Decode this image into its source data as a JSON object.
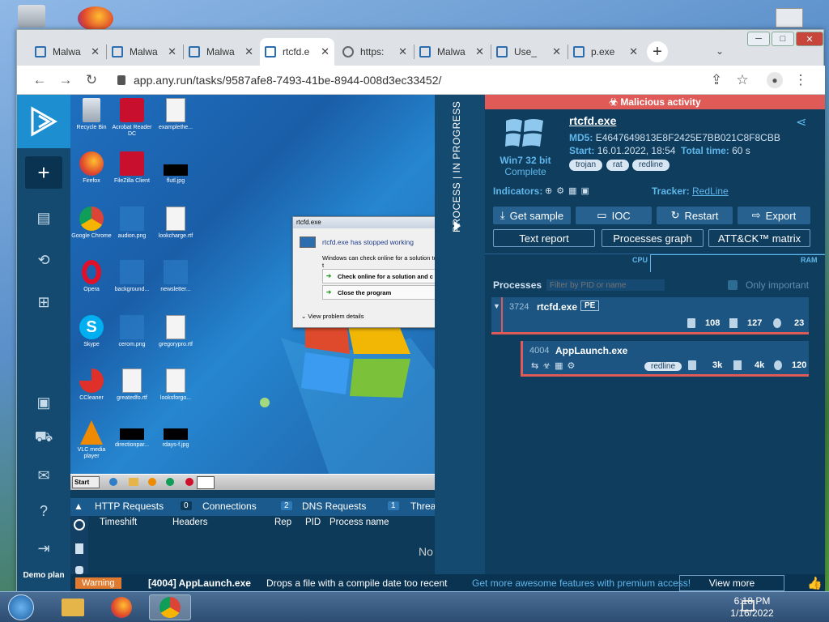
{
  "browser": {
    "tabs": [
      {
        "title": "Malwa",
        "icon": "anyrun-icon"
      },
      {
        "title": "Malwa",
        "icon": "anyrun-icon"
      },
      {
        "title": "Malwa",
        "icon": "anyrun-icon"
      },
      {
        "title": "rtcfd.e",
        "icon": "anyrun-icon",
        "active": true
      },
      {
        "title": "https:",
        "icon": "globe-icon"
      },
      {
        "title": "Malwa",
        "icon": "anyrun-icon"
      },
      {
        "title": "Use_",
        "icon": "anyrun-icon"
      },
      {
        "title": "p.exe",
        "icon": "anyrun-icon"
      }
    ],
    "url": "app.any.run/tasks/9587afe8-7493-41be-8944-008d3ec33452/"
  },
  "vm": {
    "icons": [
      "Recycle Bin",
      "Acrobat Reader DC",
      "examplethe...",
      "Firefox",
      "FileZilla Client",
      "flutl.jpg",
      "Google Chrome",
      "audion.png",
      "lookcharge.rtf",
      "Opera",
      "background...",
      "newsletter...",
      "Skype",
      "cerom.png",
      "gregorypro.rtf",
      "CCleaner",
      "greatedfo.rtf",
      "looksforgo...",
      "VLC media player",
      "directionpar...",
      "rdays-f.jpg"
    ],
    "dialog": {
      "title": "rtcfd.exe",
      "heading": "rtcfd.exe has stopped working",
      "body": "Windows can check online for a solution to t",
      "option1": "Check online for a solution and c",
      "option2": "Close the program",
      "details": "View problem details"
    },
    "start": "Start"
  },
  "network": {
    "tabs": [
      {
        "label": "HTTP Requests",
        "count": "0"
      },
      {
        "label": "Connections",
        "count": "2"
      },
      {
        "label": "DNS Requests",
        "count": "1"
      },
      {
        "label": "Threa",
        "count": ""
      }
    ],
    "columns": [
      "Timeshift",
      "Headers",
      "Rep",
      "PID",
      "Process name"
    ],
    "empty": "No"
  },
  "progress": "PROCESS | IN PROGRESS",
  "info": {
    "verdict": "Malicious activity",
    "filename": "rtcfd.exe",
    "md5_label": "MD5:",
    "md5": "E4647649813E8F2425E7BB021C8F8CBB",
    "start_label": "Start:",
    "start": "16.01.2022, 18:54",
    "total_label": "Total time:",
    "total": "60 s",
    "os": "Win7 32 bit",
    "os_status": "Complete",
    "tags": [
      "trojan",
      "rat",
      "redline"
    ],
    "indicators_label": "Indicators:",
    "tracker_label": "Tracker:",
    "tracker": "RedLine",
    "buttons": [
      "Get sample",
      "IOC",
      "Restart",
      "Export"
    ],
    "buttons2": [
      "Text report",
      "Processes graph",
      "ATT&CK™ matrix"
    ],
    "cpu": "CPU",
    "ram": "RAM",
    "processes_label": "Processes",
    "filter_placeholder": "Filter by PID or name",
    "only_important": "Only important",
    "proc1": {
      "pid": "3724",
      "name": "rtcfd.exe",
      "badge": "PE",
      "files": "108",
      "reg": "127",
      "net": "23"
    },
    "proc2": {
      "pid": "4004",
      "name": "AppLaunch.exe",
      "tag": "redline",
      "files": "3k",
      "reg": "4k",
      "net": "120"
    }
  },
  "warning": {
    "badge": "Warning",
    "process": "[4004] AppLaunch.exe",
    "message": "Drops a file with a compile date too recent",
    "promo": "Get more awesome features with premium access!",
    "view_more": "View more"
  },
  "sidebar": {
    "demo": "Demo plan"
  },
  "host": {
    "time": "6:18 PM",
    "date": "1/16/2022"
  },
  "colors": {
    "accent": "#1d8fd1",
    "malicious": "#e05b57",
    "panel": "#0f3d5e"
  }
}
